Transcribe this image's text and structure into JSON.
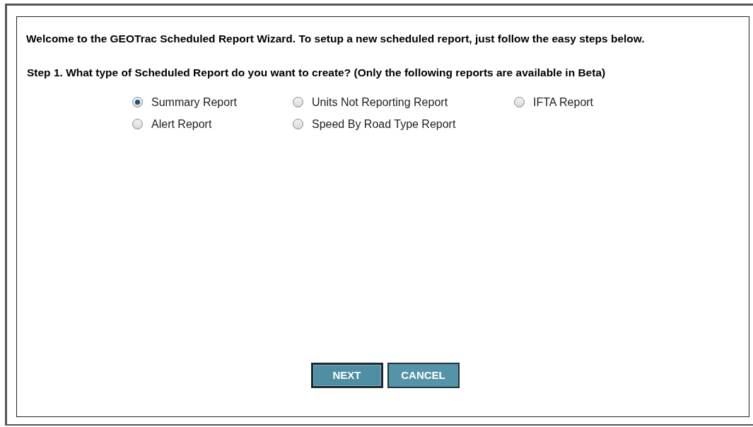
{
  "intro": "Welcome to the GEOTrac Scheduled Report Wizard. To setup a new scheduled report, just follow the easy steps below.",
  "step": "Step 1. What type of Scheduled Report do you want to create? (Only the following reports are available in Beta)",
  "report_types": [
    {
      "label": "Summary Report",
      "selected": true
    },
    {
      "label": "Units Not Reporting Report",
      "selected": false
    },
    {
      "label": "IFTA Report",
      "selected": false
    },
    {
      "label": "Alert Report",
      "selected": false
    },
    {
      "label": "Speed By Road Type Report",
      "selected": false
    }
  ],
  "buttons": [
    {
      "label": "NEXT",
      "focused": true
    },
    {
      "label": "CANCEL",
      "focused": false
    }
  ]
}
